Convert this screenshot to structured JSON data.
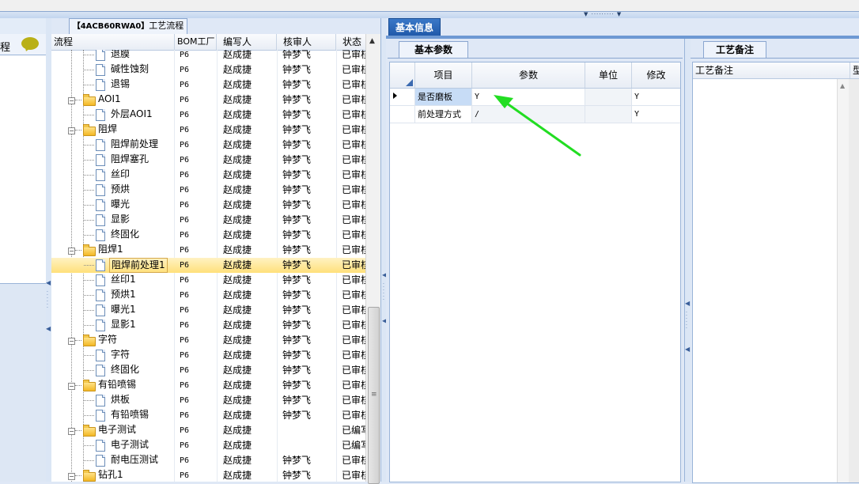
{
  "left_panel": {
    "label": "程"
  },
  "process_panel": {
    "title_prefix": "【4ACB60RWA0】",
    "title_suffix": "工艺流程",
    "columns": [
      "流程",
      "BOM工厂",
      "编写人",
      "核审人",
      "状态"
    ],
    "rows": [
      {
        "level": 2,
        "type": "doc",
        "name": "退膜",
        "bom": "P6",
        "writer": "赵成捷",
        "reviewer": "钟梦飞",
        "status": "已审核"
      },
      {
        "level": 2,
        "type": "doc",
        "name": "碱性蚀刻",
        "bom": "P6",
        "writer": "赵成捷",
        "reviewer": "钟梦飞",
        "status": "已审核"
      },
      {
        "level": 2,
        "type": "doc",
        "name": "退锡",
        "bom": "P6",
        "writer": "赵成捷",
        "reviewer": "钟梦飞",
        "status": "已审核"
      },
      {
        "level": 1,
        "type": "folder",
        "name": "AOI1",
        "bom": "P6",
        "writer": "赵成捷",
        "reviewer": "钟梦飞",
        "status": "已审核"
      },
      {
        "level": 2,
        "type": "doc",
        "name": "外层AOI1",
        "bom": "P6",
        "writer": "赵成捷",
        "reviewer": "钟梦飞",
        "status": "已审核"
      },
      {
        "level": 1,
        "type": "folder",
        "name": "阻焊",
        "bom": "P6",
        "writer": "赵成捷",
        "reviewer": "钟梦飞",
        "status": "已审核"
      },
      {
        "level": 2,
        "type": "doc",
        "name": "阻焊前处理",
        "bom": "P6",
        "writer": "赵成捷",
        "reviewer": "钟梦飞",
        "status": "已审核"
      },
      {
        "level": 2,
        "type": "doc",
        "name": "阻焊塞孔",
        "bom": "P6",
        "writer": "赵成捷",
        "reviewer": "钟梦飞",
        "status": "已审核"
      },
      {
        "level": 2,
        "type": "doc",
        "name": "丝印",
        "bom": "P6",
        "writer": "赵成捷",
        "reviewer": "钟梦飞",
        "status": "已审核"
      },
      {
        "level": 2,
        "type": "doc",
        "name": "预烘",
        "bom": "P6",
        "writer": "赵成捷",
        "reviewer": "钟梦飞",
        "status": "已审核"
      },
      {
        "level": 2,
        "type": "doc",
        "name": "曝光",
        "bom": "P6",
        "writer": "赵成捷",
        "reviewer": "钟梦飞",
        "status": "已审核"
      },
      {
        "level": 2,
        "type": "doc",
        "name": "显影",
        "bom": "P6",
        "writer": "赵成捷",
        "reviewer": "钟梦飞",
        "status": "已审核"
      },
      {
        "level": 2,
        "type": "doc",
        "name": "终固化",
        "bom": "P6",
        "writer": "赵成捷",
        "reviewer": "钟梦飞",
        "status": "已审核"
      },
      {
        "level": 1,
        "type": "folder",
        "name": "阻焊1",
        "bom": "P6",
        "writer": "赵成捷",
        "reviewer": "钟梦飞",
        "status": "已审核"
      },
      {
        "level": 2,
        "type": "doc",
        "name": "阻焊前处理1",
        "bom": "P6",
        "writer": "赵成捷",
        "reviewer": "钟梦飞",
        "status": "已审核",
        "selected": true
      },
      {
        "level": 2,
        "type": "doc",
        "name": "丝印1",
        "bom": "P6",
        "writer": "赵成捷",
        "reviewer": "钟梦飞",
        "status": "已审核"
      },
      {
        "level": 2,
        "type": "doc",
        "name": "预烘1",
        "bom": "P6",
        "writer": "赵成捷",
        "reviewer": "钟梦飞",
        "status": "已审核"
      },
      {
        "level": 2,
        "type": "doc",
        "name": "曝光1",
        "bom": "P6",
        "writer": "赵成捷",
        "reviewer": "钟梦飞",
        "status": "已审核"
      },
      {
        "level": 2,
        "type": "doc",
        "name": "显影1",
        "bom": "P6",
        "writer": "赵成捷",
        "reviewer": "钟梦飞",
        "status": "已审核"
      },
      {
        "level": 1,
        "type": "folder",
        "name": "字符",
        "bom": "P6",
        "writer": "赵成捷",
        "reviewer": "钟梦飞",
        "status": "已审核"
      },
      {
        "level": 2,
        "type": "doc",
        "name": "字符",
        "bom": "P6",
        "writer": "赵成捷",
        "reviewer": "钟梦飞",
        "status": "已审核"
      },
      {
        "level": 2,
        "type": "doc",
        "name": "终固化",
        "bom": "P6",
        "writer": "赵成捷",
        "reviewer": "钟梦飞",
        "status": "已审核"
      },
      {
        "level": 1,
        "type": "folder",
        "name": "有铅喷锡",
        "bom": "P6",
        "writer": "赵成捷",
        "reviewer": "钟梦飞",
        "status": "已审核"
      },
      {
        "level": 2,
        "type": "doc",
        "name": "烘板",
        "bom": "P6",
        "writer": "赵成捷",
        "reviewer": "钟梦飞",
        "status": "已审核"
      },
      {
        "level": 2,
        "type": "doc",
        "name": "有铅喷锡",
        "bom": "P6",
        "writer": "赵成捷",
        "reviewer": "钟梦飞",
        "status": "已审核"
      },
      {
        "level": 1,
        "type": "folder",
        "name": "电子测试",
        "bom": "P6",
        "writer": "赵成捷",
        "reviewer": "",
        "status": "已编写"
      },
      {
        "level": 2,
        "type": "doc",
        "name": "电子测试",
        "bom": "P6",
        "writer": "赵成捷",
        "reviewer": "",
        "status": "已编写"
      },
      {
        "level": 2,
        "type": "doc",
        "name": "耐电压测试",
        "bom": "P6",
        "writer": "赵成捷",
        "reviewer": "钟梦飞",
        "status": "已审核"
      },
      {
        "level": 1,
        "type": "folder",
        "name": "钻孔1",
        "bom": "P6",
        "writer": "赵成捷",
        "reviewer": "钟梦飞",
        "status": "已审核"
      }
    ]
  },
  "info_panel": {
    "tab": "基本信息",
    "params_tab": "基本参数",
    "columns": [
      "项目",
      "参数",
      "单位",
      "修改"
    ],
    "rows": [
      {
        "item": "是否磨板",
        "param": "Y",
        "unit": "",
        "modify": "Y"
      },
      {
        "item": "前处理方式",
        "param": "/",
        "unit": "",
        "modify": "Y"
      }
    ]
  },
  "notes_panel": {
    "tab": "工艺备注",
    "column": "工艺备注",
    "column2": "型"
  },
  "colors": {
    "accent": "#1f58a8",
    "selection": "#ffe07a",
    "annotation_arrow": "#22dd22"
  }
}
